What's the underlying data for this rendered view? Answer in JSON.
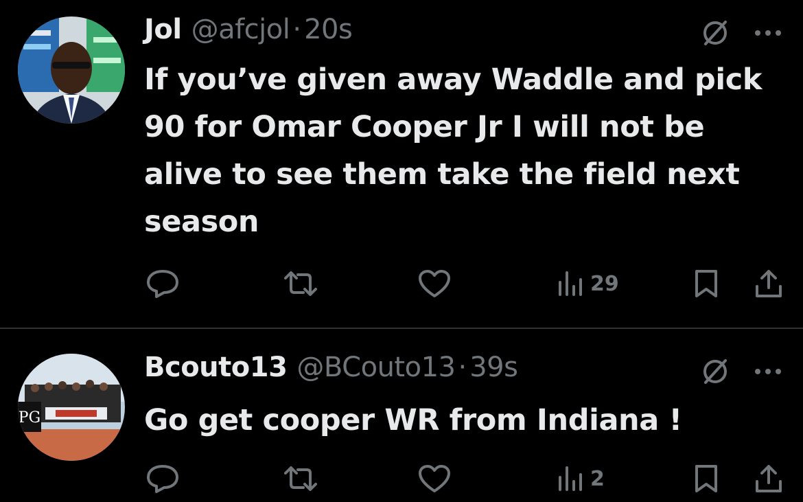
{
  "tweets": [
    {
      "name": "Jol",
      "handle": "@afcjol",
      "separator": "·",
      "time": "20s",
      "text": "If you’ve given away Waddle and pick 90 for Omar Cooper Jr I will not be alive to see them take the field next season",
      "views": "29"
    },
    {
      "name": "Bcouto13",
      "handle": "@BCouto13",
      "separator": "·",
      "time": "39s",
      "text": "Go get cooper WR from Indiana !",
      "views": "2"
    }
  ],
  "colors": {
    "background": "#000000",
    "primary_text": "#e7e9ea",
    "secondary_text": "#71767b",
    "divider": "#2f3336"
  },
  "icons": [
    "grok-icon",
    "more-icon",
    "reply-icon",
    "retweet-icon",
    "like-icon",
    "views-icon",
    "bookmark-icon",
    "share-icon"
  ]
}
